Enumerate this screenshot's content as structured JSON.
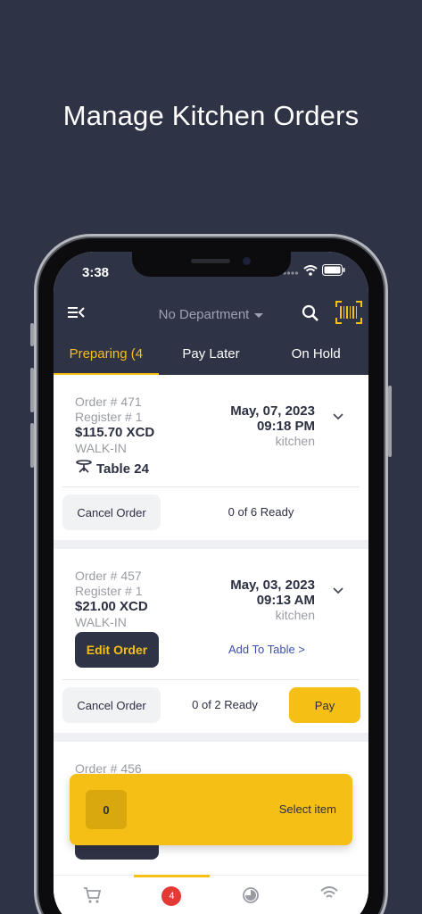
{
  "headline": "Manage Kitchen Orders",
  "status_bar": {
    "time": "3:38"
  },
  "toolbar": {
    "department": "No Department"
  },
  "tabs": [
    {
      "label": "Preparing (4"
    },
    {
      "label": "Pay Later"
    },
    {
      "label": "On Hold"
    }
  ],
  "orders": [
    {
      "order": "Order # 471",
      "register": "Register # 1",
      "amount": "$115.70 XCD",
      "type": "WALK-IN",
      "table": "Table 24",
      "date": "May, 07, 2023",
      "time": "09:18 PM",
      "location": "kitchen",
      "cancel_label": "Cancel Order",
      "ready": "0 of 6 Ready"
    },
    {
      "order": "Order # 457",
      "register": "Register # 1",
      "amount": "$21.00 XCD",
      "type": "WALK-IN",
      "date": "May, 03, 2023",
      "time": "09:13 AM",
      "location": "kitchen",
      "edit_label": "Edit Order",
      "add_table_label": "Add To Table >",
      "cancel_label": "Cancel Order",
      "ready": "0 of 2 Ready",
      "pay_label": "Pay"
    },
    {
      "order": "Order # 456"
    }
  ],
  "toast": {
    "count": "0",
    "label": "Select item"
  },
  "bottom_nav": {
    "badge": "4"
  },
  "colors": {
    "accent": "#f5bf16",
    "dark": "#2f3346",
    "link": "#3c4fb1",
    "badge": "#e53935"
  }
}
